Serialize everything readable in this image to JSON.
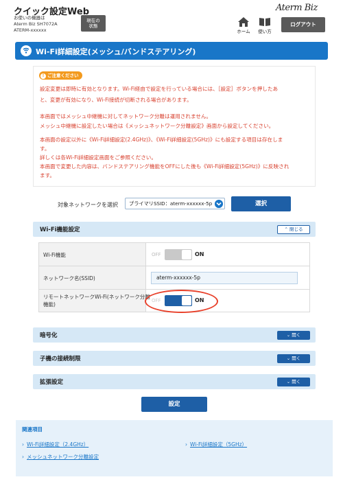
{
  "header": {
    "app_title": "クイック設定Web",
    "device_info_line1": "お使いの機器は",
    "device_info_line2": "Aterm Biz SH7072A",
    "device_info_line3": "ATERM-xxxxxx",
    "status_button_line1": "現在の",
    "status_button_line2": "状態",
    "brand": "Aterm Biz",
    "home_label": "ホーム",
    "guide_label": "使い方",
    "logout_label": "ログアウト"
  },
  "page": {
    "title": "Wi-Fi詳細設定(メッシュ/バンドステアリング)"
  },
  "caution": {
    "tag": "ご注意ください",
    "lines": [
      "設定変更は即時に有効となります。Wi-Fi経由で設定を行っている場合には、［設定］ボタンを押したあ",
      "と、変更が有効になり、Wi-Fi接続が切断される場合があります。",
      "本画面ではメッシュ中継機に対してネットワーク分離は運用されません。",
      "メッシュ中継機に設定したい場合は《メッシュネットワーク分離設定》画面から設定してください。",
      "本画面の設定以外に《Wi-Fi詳細設定(2.4GHz)》、《Wi-Fi詳細設定(5GHz)》にも設定する項目は存在しま",
      "す。",
      "詳しくは各Wi-Fi詳細設定画面をご参照ください。",
      "本画面で変更した内容は、バンドステアリング機能をOFFにした後も《Wi-Fi詳細設定(5GHz)》に反映され",
      "ます。"
    ]
  },
  "target": {
    "label": "対象ネットワークを選択",
    "selected": "プライマリSSID：aterm-xxxxxx-5p",
    "select_button": "選択"
  },
  "sections": {
    "wifi_function": {
      "label": "Wi-Fi機能設定",
      "toggle": "閉じる"
    },
    "encryption": {
      "label": "暗号化",
      "toggle": "開く"
    },
    "client_restriction": {
      "label": "子機の接続制限",
      "toggle": "開く"
    },
    "extended": {
      "label": "拡張設定",
      "toggle": "開く"
    }
  },
  "wifi_table": {
    "wifi_function_label": "Wi-Fi機能",
    "wifi_function_off": "OFF",
    "wifi_function_on": "ON",
    "wifi_function_state": "on",
    "ssid_label": "ネットワーク名(SSID)",
    "ssid_value": "aterm-xxxxxx-5p",
    "remote_label_line1": "リモートネットワークWi-Fi(ネットワーク分離",
    "remote_label_line2": "機能)",
    "remote_off": "OFF",
    "remote_on": "ON",
    "remote_state": "on"
  },
  "actions": {
    "set_button": "設定"
  },
  "related": {
    "title": "関連項目",
    "links": [
      "Wi-Fi詳細設定（2.4GHz）",
      "Wi-Fi詳細設定（5GHz）",
      "メッシュネットワーク分離設定"
    ]
  },
  "colors": {
    "accent": "#1976c8",
    "button": "#1e5fa6",
    "warning_text": "#d8412f",
    "highlight": "#e8402a"
  }
}
